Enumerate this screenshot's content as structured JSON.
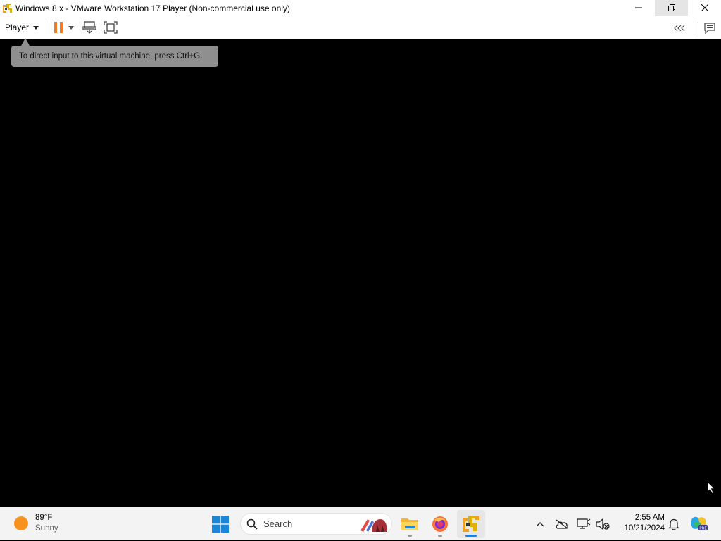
{
  "window": {
    "title": "Windows 8.x - VMware Workstation 17 Player (Non-commercial use only)",
    "controls": [
      "minimize-icon",
      "restore-icon",
      "close-icon"
    ]
  },
  "toolbar": {
    "player_menu_label": "Player",
    "icons": [
      "pause-icon",
      "pause-dropdown-icon",
      "send-ctrl-alt-del-icon",
      "fullscreen-icon",
      "collapse-toolbar-icon",
      "message-log-icon"
    ],
    "accent_color": "#f07b20"
  },
  "vm": {
    "tooltip": "To direct input to this virtual machine, press Ctrl+G."
  },
  "taskbar": {
    "weather": {
      "temp": "89°F",
      "condition": "Sunny",
      "icon": "sun-icon"
    },
    "search": {
      "placeholder": "Search"
    },
    "apps": [
      "start-icon",
      "file-explorer-icon",
      "firefox-icon",
      "vmware-player-icon"
    ],
    "tray_icons": [
      "show-hidden-icons-chevron",
      "onedrive-icon",
      "network-icon",
      "volume-muted-icon"
    ],
    "clock": {
      "time": "2:55 AM",
      "date": "10/21/2024"
    },
    "notification_icon": "bell-icon",
    "copilot_icon": "copilot-pre-icon"
  }
}
